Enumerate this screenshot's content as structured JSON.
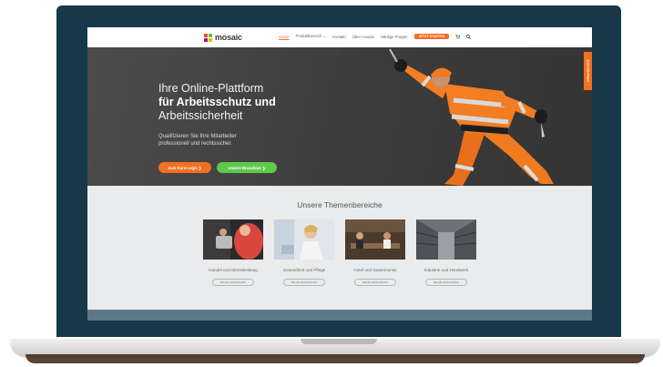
{
  "header": {
    "logo_text": "mosaic",
    "nav_items": [
      "Home",
      "Produktbereich",
      "Kontakt",
      "Über mosaic",
      "Häufige Fragen"
    ],
    "cta_label": "JETZT STARTEN"
  },
  "hero": {
    "title_line1": "Ihre Online-Plattform",
    "title_line2": "für Arbeitsschutz und",
    "title_line3": "Arbeitssicherheit",
    "subtitle_line1": "Qualifizieren Sie Ihre Mitarbeiter",
    "subtitle_line2": "professionell und rechtssicher.",
    "login_button": "Zum Kurs-Login ❯",
    "brochure_button": "Unsere Broschüre ❯",
    "side_tab": "Jetzt Info-Paket"
  },
  "topics": {
    "title": "Unsere Themenbereiche",
    "button_label": "MEHR ERFAHREN",
    "items": [
      {
        "label": "Handel und Dienstleistung"
      },
      {
        "label": "Gesundheit und Pflege"
      },
      {
        "label": "Hotel und Gastronomie"
      },
      {
        "label": "Industrie und Handwerk"
      }
    ]
  },
  "colors": {
    "accent": "#f36f21",
    "green": "#5ec94b",
    "bezel": "#163848"
  }
}
